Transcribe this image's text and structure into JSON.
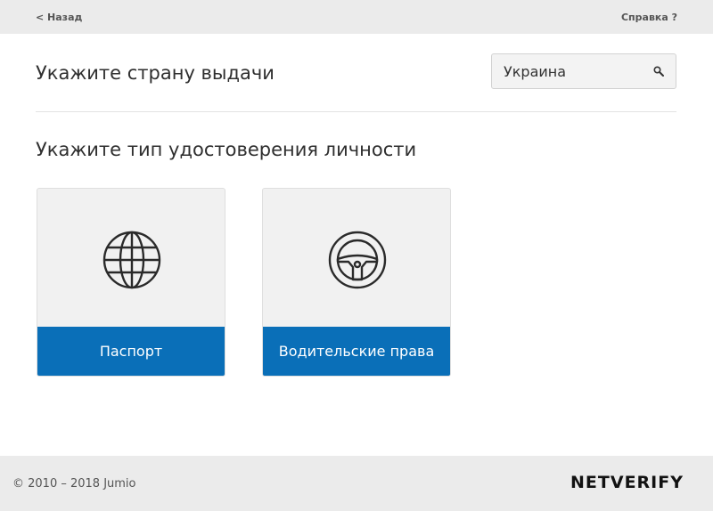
{
  "header": {
    "back_label": "< Назад",
    "help_label": "Справка ?"
  },
  "country": {
    "title": "Укажите страну выдачи",
    "selected": "Украина",
    "icon": "search-icon"
  },
  "document": {
    "title": "Укажите тип удостоверения личности",
    "options": [
      {
        "label": "Паспорт",
        "icon": "globe-icon"
      },
      {
        "label": "Водительские права",
        "icon": "steering-wheel-icon"
      }
    ]
  },
  "footer": {
    "copyright": "© 2010 – 2018 Jumio",
    "brand": "NETVERIFY"
  },
  "colors": {
    "accent": "#0a6fb8",
    "bar_background": "#ebebeb",
    "card_background": "#f1f1f1"
  }
}
